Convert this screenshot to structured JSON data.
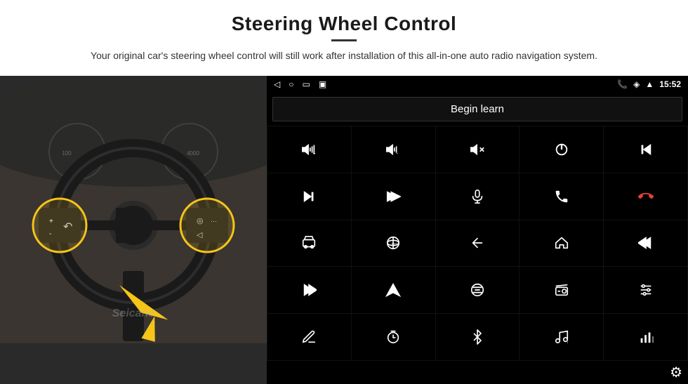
{
  "page": {
    "title": "Steering Wheel Control",
    "subtitle": "Your original car's steering wheel control will still work after installation of this all-in-one auto radio navigation system."
  },
  "status_bar": {
    "time": "15:52",
    "icons_left": [
      "back-arrow",
      "home-circle",
      "square"
    ]
  },
  "begin_learn_button": "Begin learn",
  "icon_grid": [
    {
      "id": "vol-up",
      "symbol": "vol+"
    },
    {
      "id": "vol-down",
      "symbol": "vol-"
    },
    {
      "id": "vol-mute",
      "symbol": "vol-x"
    },
    {
      "id": "power",
      "symbol": "power"
    },
    {
      "id": "prev-track",
      "symbol": "|<"
    },
    {
      "id": "next-track",
      "symbol": ">|"
    },
    {
      "id": "shuffle",
      "symbol": "shuf"
    },
    {
      "id": "mic",
      "symbol": "mic"
    },
    {
      "id": "phone",
      "symbol": "phone"
    },
    {
      "id": "hang-up",
      "symbol": "hang"
    },
    {
      "id": "car",
      "symbol": "car"
    },
    {
      "id": "view360",
      "symbol": "360"
    },
    {
      "id": "back",
      "symbol": "back"
    },
    {
      "id": "home",
      "symbol": "home"
    },
    {
      "id": "skip-back",
      "symbol": "<<"
    },
    {
      "id": "fast-fwd",
      "symbol": ">>"
    },
    {
      "id": "nav",
      "symbol": "nav"
    },
    {
      "id": "equalizer",
      "symbol": "eq"
    },
    {
      "id": "radio",
      "symbol": "radio"
    },
    {
      "id": "settings2",
      "symbol": "sliders"
    },
    {
      "id": "edit",
      "symbol": "edit"
    },
    {
      "id": "timer",
      "symbol": "timer"
    },
    {
      "id": "bluetooth",
      "symbol": "bt"
    },
    {
      "id": "music",
      "symbol": "music"
    },
    {
      "id": "bars",
      "symbol": "bars"
    }
  ],
  "settings_icon": "gear"
}
